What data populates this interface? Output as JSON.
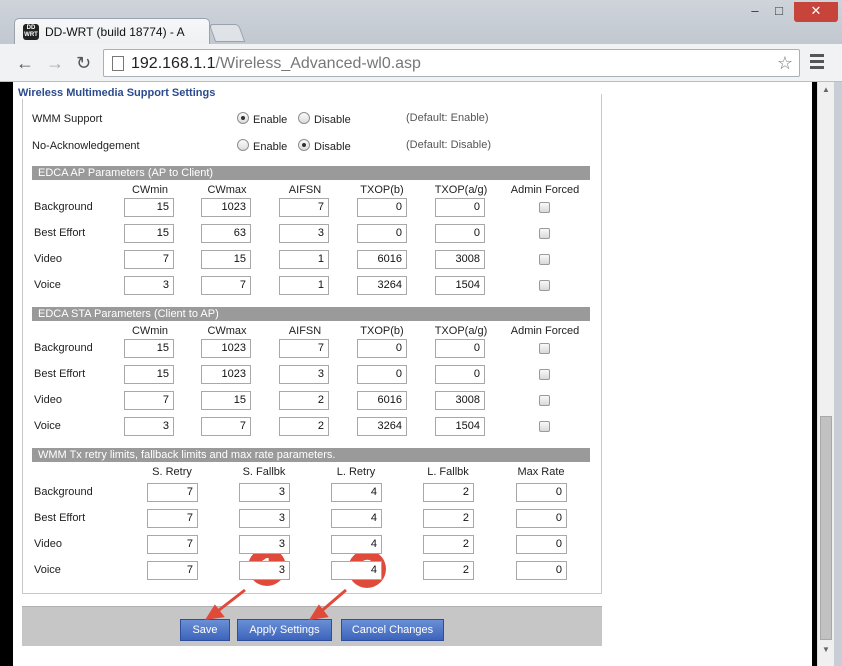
{
  "browser": {
    "tab_title": "DD-WRT (build 18774) - A",
    "tab_logo": "DD WRT",
    "url_host": "192.168.1.1",
    "url_path": "/Wireless_Advanced-wl0.asp",
    "icons": {
      "back": "←",
      "forward": "→",
      "reload": "↻",
      "star": "☆",
      "minimize": "–",
      "maximize": "□",
      "close": "✕"
    }
  },
  "wmm": {
    "legend": "Wireless Multimedia Support Settings",
    "support": {
      "label": "WMM Support",
      "enable": "Enable",
      "disable": "Disable",
      "selected": "Enable",
      "default": "(Default: Enable)"
    },
    "noack": {
      "label": "No-Acknowledgement",
      "enable": "Enable",
      "disable": "Disable",
      "selected": "Disable",
      "default": "(Default: Disable)"
    }
  },
  "edca_ap": {
    "title": "EDCA AP Parameters (AP to Client)",
    "columns": [
      "CWmin",
      "CWmax",
      "AIFSN",
      "TXOP(b)",
      "TXOP(a/g)",
      "Admin Forced"
    ],
    "rows": [
      {
        "label": "Background",
        "values": [
          "15",
          "1023",
          "7",
          "0",
          "0"
        ],
        "forced": false
      },
      {
        "label": "Best Effort",
        "values": [
          "15",
          "63",
          "3",
          "0",
          "0"
        ],
        "forced": false
      },
      {
        "label": "Video",
        "values": [
          "7",
          "15",
          "1",
          "6016",
          "3008"
        ],
        "forced": false
      },
      {
        "label": "Voice",
        "values": [
          "3",
          "7",
          "1",
          "3264",
          "1504"
        ],
        "forced": false
      }
    ]
  },
  "edca_sta": {
    "title": "EDCA STA Parameters (Client to AP)",
    "columns": [
      "CWmin",
      "CWmax",
      "AIFSN",
      "TXOP(b)",
      "TXOP(a/g)",
      "Admin Forced"
    ],
    "rows": [
      {
        "label": "Background",
        "values": [
          "15",
          "1023",
          "7",
          "0",
          "0"
        ],
        "forced": false
      },
      {
        "label": "Best Effort",
        "values": [
          "15",
          "1023",
          "3",
          "0",
          "0"
        ],
        "forced": false
      },
      {
        "label": "Video",
        "values": [
          "7",
          "15",
          "2",
          "6016",
          "3008"
        ],
        "forced": false
      },
      {
        "label": "Voice",
        "values": [
          "3",
          "7",
          "2",
          "3264",
          "1504"
        ],
        "forced": false
      }
    ]
  },
  "retry": {
    "title": "WMM Tx retry limits, fallback limits and max rate parameters.",
    "columns": [
      "S. Retry",
      "S. Fallbk",
      "L. Retry",
      "L. Fallbk",
      "Max Rate"
    ],
    "rows": [
      {
        "label": "Background",
        "values": [
          "7",
          "3",
          "4",
          "2",
          "0"
        ]
      },
      {
        "label": "Best Effort",
        "values": [
          "7",
          "3",
          "4",
          "2",
          "0"
        ]
      },
      {
        "label": "Video",
        "values": [
          "7",
          "3",
          "4",
          "2",
          "0"
        ]
      },
      {
        "label": "Voice",
        "values": [
          "7",
          "3",
          "4",
          "2",
          "0"
        ]
      }
    ]
  },
  "footer": {
    "save": "Save",
    "apply": "Apply Settings",
    "cancel": "Cancel Changes"
  },
  "annotations": {
    "badge1": "1",
    "badge2": "2",
    "color": "#e04a3b"
  }
}
